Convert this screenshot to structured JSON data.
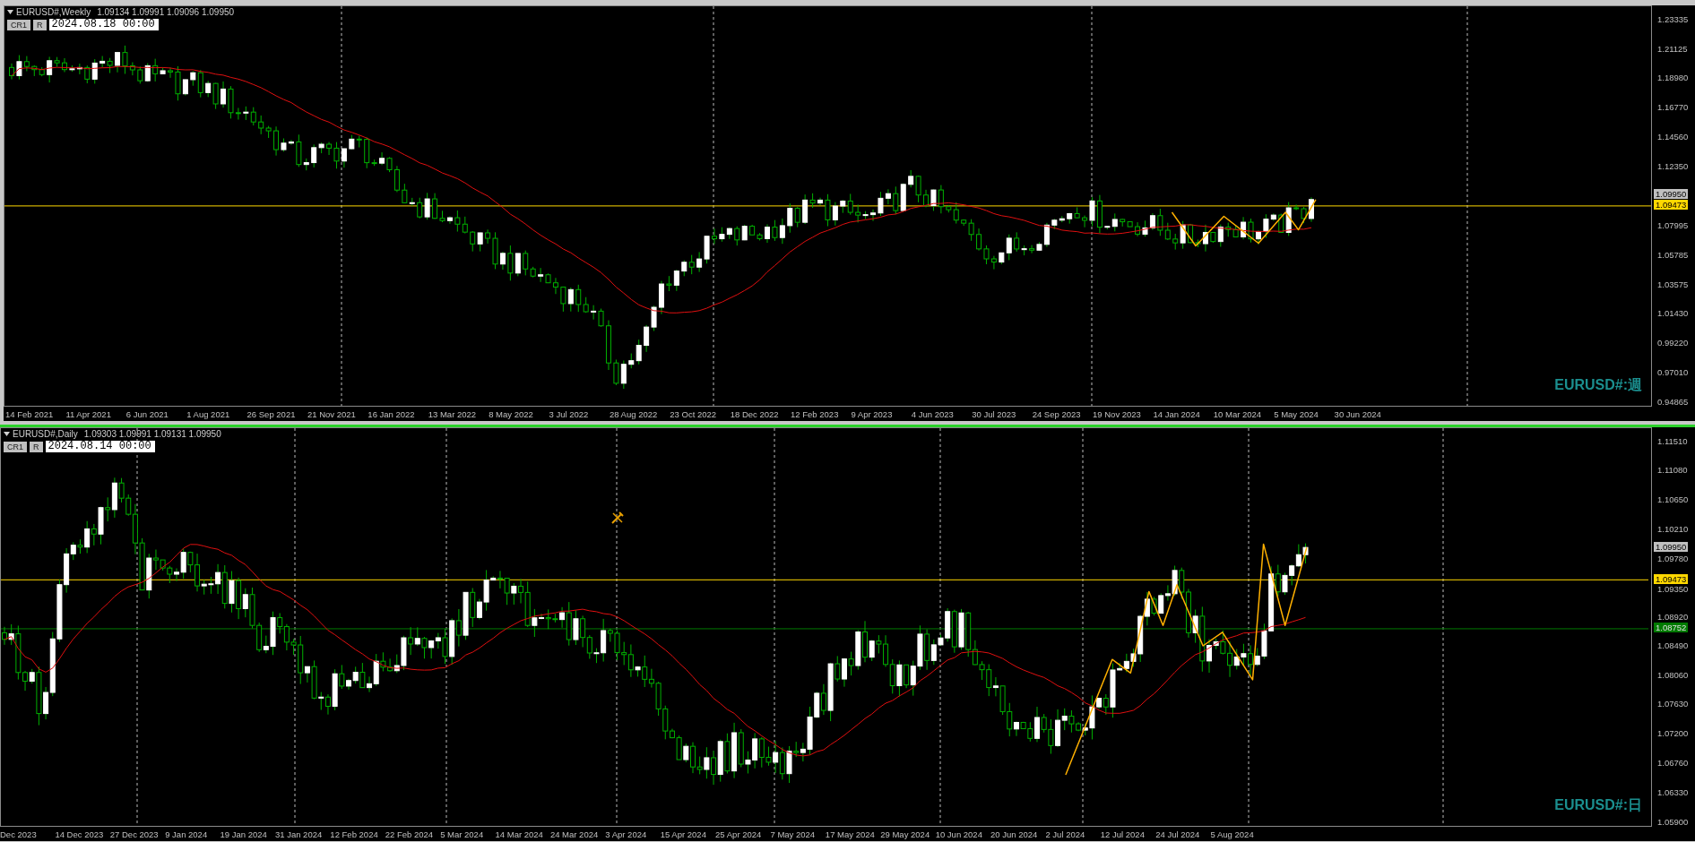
{
  "panes": [
    {
      "kind": "weekly",
      "active": false,
      "title": "EURUSD#,Weekly",
      "ohlc": "1.09134 1.09991 1.09096 1.09950",
      "buttons": [
        "CR1",
        "R"
      ],
      "crosshair_time": "2024.08.18 00:00",
      "price_axis": [
        "1.23335",
        "1.21125",
        "1.18980",
        "1.16770",
        "1.14560",
        "1.12350",
        "1.07995",
        "1.05785",
        "1.03575",
        "1.01430",
        "0.99220",
        "0.97010",
        "0.94865"
      ],
      "price_markers": [
        {
          "value": "1.09950",
          "kind": "current",
          "color": "#c0c0c0"
        },
        {
          "value": "1.09473",
          "kind": "line",
          "color": "#ffd700"
        }
      ],
      "time_axis": [
        "14 Feb 2021",
        "11 Apr 2021",
        "6 Jun 2021",
        "1 Aug 2021",
        "26 Sep 2021",
        "21 Nov 2021",
        "16 Jan 2022",
        "13 Mar 2022",
        "8 May 2022",
        "3 Jul 2022",
        "28 Aug 2022",
        "23 Oct 2022",
        "18 Dec 2022",
        "12 Feb 2023",
        "9 Apr 2023",
        "4 Jun 2023",
        "30 Jul 2023",
        "24 Sep 2023",
        "19 Nov 2023",
        "14 Jan 2024",
        "10 Mar 2024",
        "5 May 2024",
        "30 Jun 2024"
      ],
      "watermark": "EURUSD#:週"
    },
    {
      "kind": "daily",
      "active": true,
      "cursor_icon": true,
      "title": "EURUSD#,Daily",
      "ohlc": "1.09303 1.09991 1.09131 1.09950",
      "buttons": [
        "CR1",
        "R"
      ],
      "crosshair_time": "2024.08.14 00:00",
      "price_axis": [
        "1.11510",
        "1.11080",
        "1.10650",
        "1.10210",
        "1.09780",
        "1.09350",
        "1.08920",
        "1.08490",
        "1.08060",
        "1.07630",
        "1.07200",
        "1.06760",
        "1.06330",
        "1.05900"
      ],
      "price_markers": [
        {
          "value": "1.09950",
          "kind": "current",
          "color": "#c0c0c0"
        },
        {
          "value": "1.09473",
          "kind": "line",
          "color": "#ffd700"
        },
        {
          "value": "1.08752",
          "kind": "line",
          "color": "#007a00"
        }
      ],
      "time_axis": [
        "Dec 2023",
        "14 Dec 2023",
        "27 Dec 2023",
        "9 Jan 2024",
        "19 Jan 2024",
        "31 Jan 2024",
        "12 Feb 2024",
        "22 Feb 2024",
        "5 Mar 2024",
        "14 Mar 2024",
        "24 Mar 2024",
        "3 Apr 2024",
        "15 Apr 2024",
        "25 Apr 2024",
        "7 May 2024",
        "17 May 2024",
        "29 May 2024",
        "10 Jun 2024",
        "20 Jun 2024",
        "2 Jul 2024",
        "12 Jul 2024",
        "24 Jul 2024",
        "5 Aug 2024"
      ],
      "watermark": "EURUSD#:日"
    }
  ]
}
